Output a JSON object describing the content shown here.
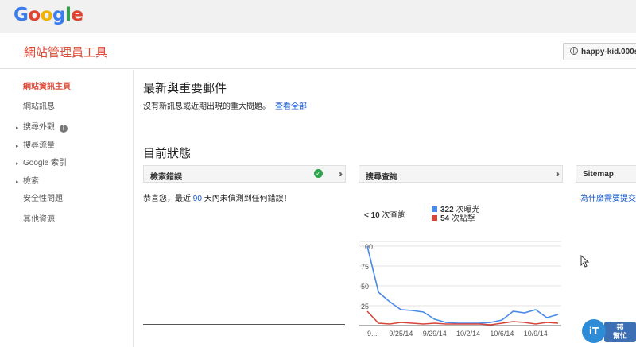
{
  "logo": {
    "letters": [
      "G",
      "o",
      "o",
      "g",
      "l",
      "e"
    ]
  },
  "header": {
    "title": "網站管理員工具",
    "site": "happy-kid.000sp"
  },
  "sidebar": {
    "items": [
      {
        "label": "網站資訊主頁",
        "active": true,
        "expandable": false
      },
      {
        "label": "網站訊息",
        "active": false,
        "expandable": false
      },
      {
        "label": "搜尋外觀",
        "active": false,
        "expandable": true,
        "info": "i"
      },
      {
        "label": "搜尋流量",
        "active": false,
        "expandable": true
      },
      {
        "label": "Google 索引",
        "active": false,
        "expandable": true
      },
      {
        "label": "檢索",
        "active": false,
        "expandable": true
      },
      {
        "label": "安全性問題",
        "active": false,
        "expandable": false
      },
      {
        "label": "其他資源",
        "active": false,
        "expandable": false
      }
    ],
    "expand_glyph": "▸"
  },
  "messages": {
    "title": "最新與重要郵件",
    "text": "沒有新訊息或近期出現的重大問題。",
    "link": "查看全部"
  },
  "status": {
    "title": "目前狀態",
    "panels": {
      "crawl_errors": {
        "title": "檢索錯誤",
        "expand": "»",
        "check": "✓"
      },
      "search_queries": {
        "title": "搜尋查詢",
        "expand": "»"
      },
      "sitemap": {
        "title": "Sitemap"
      }
    },
    "crawl_message_pre": "恭喜您，最近",
    "crawl_message_num": "90",
    "crawl_message_post": "天內未偵測到任何錯誤！",
    "queries_label_count": "< 10",
    "queries_label_unit": "次查詢",
    "impressions_count": "322",
    "impressions_unit": "次曝光",
    "clicks_count": "54",
    "clicks_unit": "次點擊",
    "sitemap_link": "為什麼需要提交"
  },
  "badge": {
    "logo": "iT",
    "line1": "邦",
    "line2": "幫忙"
  },
  "colors": {
    "impressions": "#4a8ae8",
    "clicks": "#d9443a"
  },
  "chart_data": {
    "type": "line",
    "x": [
      "9...",
      "",
      "",
      "9/25/14",
      "",
      "",
      "9/29/14",
      "",
      "",
      "10/2/14",
      "",
      "",
      "10/6/14",
      "",
      "",
      "10/9/14",
      "",
      ""
    ],
    "ylim": [
      0,
      100
    ],
    "yticks": [
      100,
      75,
      50,
      25
    ],
    "series": [
      {
        "name": "次曝光",
        "values": [
          100,
          42,
          30,
          20,
          19,
          17,
          8,
          4,
          3,
          3,
          3,
          4,
          7,
          18,
          16,
          20,
          10,
          14
        ]
      },
      {
        "name": "次點擊",
        "values": [
          18,
          3,
          2,
          4,
          3,
          2,
          3,
          2,
          2,
          2,
          2,
          1,
          3,
          5,
          4,
          2,
          4,
          3
        ]
      }
    ],
    "xticks_shown": [
      "9...",
      "9/25/14",
      "9/29/14",
      "10/2/14",
      "10/6/14",
      "10/9/14"
    ],
    "grid": true
  }
}
